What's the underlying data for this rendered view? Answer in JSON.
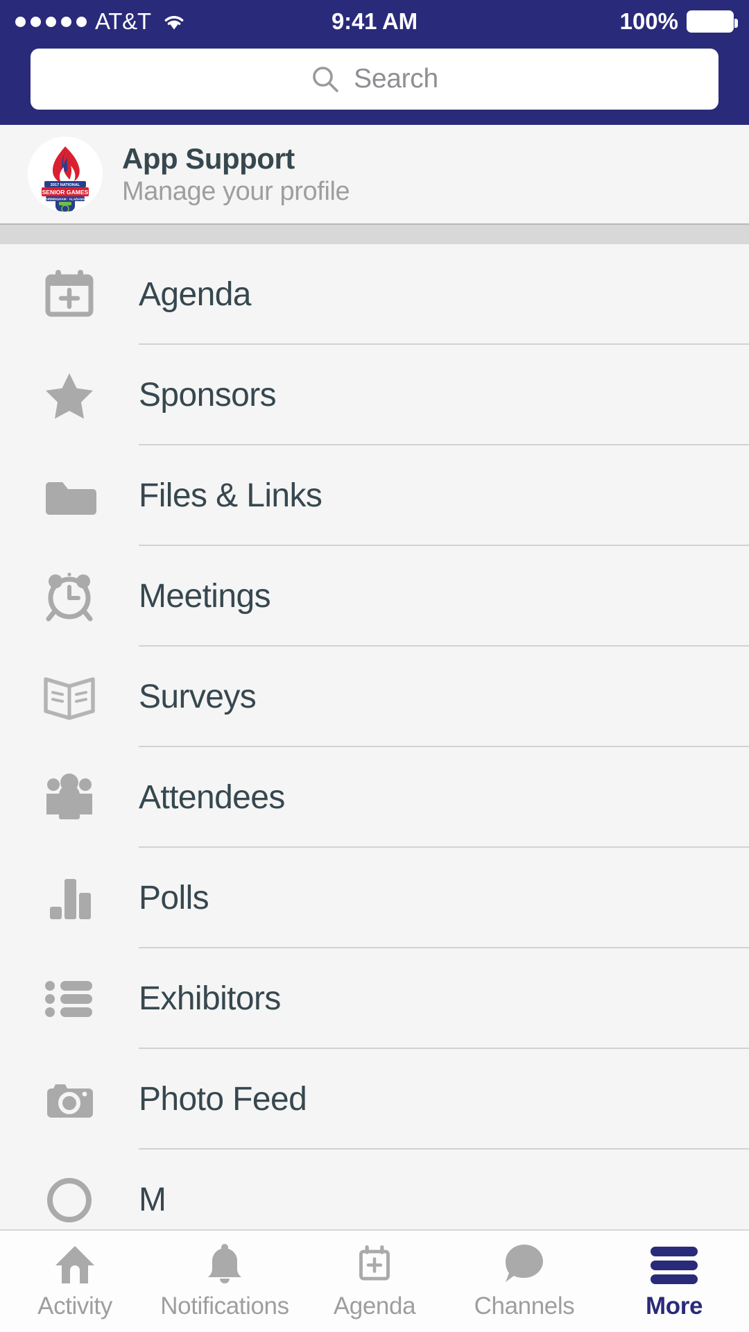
{
  "status_bar": {
    "signal_dots": 5,
    "carrier": "AT&T",
    "wifi_icon": "wifi-icon",
    "time": "9:41 AM",
    "battery_percent": "100%",
    "battery_icon": "battery-full-icon"
  },
  "search": {
    "icon": "search-icon",
    "placeholder": "Search",
    "value": ""
  },
  "profile": {
    "avatar_icon": "senior-games-torch-logo",
    "avatar_alt": "2017 National Senior Games Birmingham Alabama torch logo",
    "name": "App Support",
    "subtitle": "Manage your profile"
  },
  "menu": {
    "items": [
      {
        "label": "Agenda",
        "icon": "calendar-plus-icon"
      },
      {
        "label": "Sponsors",
        "icon": "star-icon"
      },
      {
        "label": "Files & Links",
        "icon": "folder-icon"
      },
      {
        "label": "Meetings",
        "icon": "alarm-clock-icon"
      },
      {
        "label": "Surveys",
        "icon": "open-book-icon"
      },
      {
        "label": "Attendees",
        "icon": "people-group-icon"
      },
      {
        "label": "Polls",
        "icon": "bar-chart-icon"
      },
      {
        "label": "Exhibitors",
        "icon": "bulleted-list-icon"
      },
      {
        "label": "Photo Feed",
        "icon": "camera-icon"
      },
      {
        "label": "M",
        "icon": "circle-icon"
      }
    ]
  },
  "tab_bar": {
    "tabs": [
      {
        "label": "Activity",
        "icon": "home-icon",
        "active": false
      },
      {
        "label": "Notifications",
        "icon": "bell-icon",
        "active": false
      },
      {
        "label": "Agenda",
        "icon": "calendar-plus-icon",
        "active": false
      },
      {
        "label": "Channels",
        "icon": "speech-bubble-icon",
        "active": false
      },
      {
        "label": "More",
        "icon": "hamburger-menu-icon",
        "active": true
      }
    ]
  },
  "colors": {
    "status_bar_bg": "#2a2a7a",
    "accent": "#2a2a7a",
    "page_bg": "#f4f5f4",
    "band_bg": "#d8d8d8",
    "icon_gray": "#aaaaaa",
    "text_dark": "#37474f",
    "text_muted": "#9e9e9e"
  }
}
